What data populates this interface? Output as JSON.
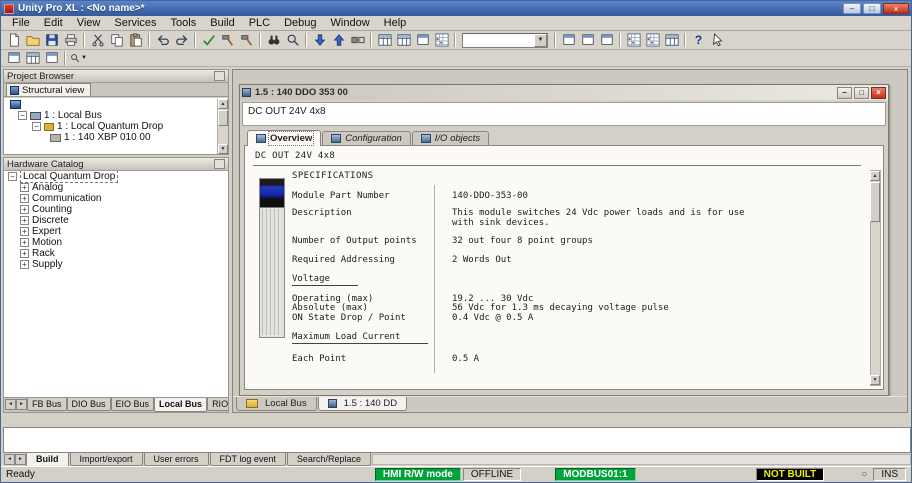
{
  "titlebar": {
    "title": "Unity Pro XL : <No name>*"
  },
  "menu": {
    "items": [
      "File",
      "Edit",
      "View",
      "Services",
      "Tools",
      "Build",
      "PLC",
      "Debug",
      "Window",
      "Help"
    ]
  },
  "toolbar": {
    "combo_value": ""
  },
  "icons": {
    "minimize": "–",
    "maximize": "□",
    "close": "×",
    "dropdown": "▼",
    "up_arrow": "▲",
    "down_arrow": "▼",
    "left_arrow": "◄",
    "right_arrow": "►",
    "collapse": "−",
    "expand": "+",
    "help": "?",
    "circle": "○"
  },
  "project_browser": {
    "title": "Project Browser",
    "view_tab": "Structural view",
    "tree": {
      "bus": "1 : Local Bus",
      "drop": "1 : Local Quantum Drop",
      "rack": "1 : 140 XBP 010 00"
    }
  },
  "hardware_catalog": {
    "title": "Hardware Catalog",
    "root": "Local Quantum Drop",
    "items": [
      "Analog",
      "Communication",
      "Counting",
      "Discrete",
      "Expert",
      "Motion",
      "Rack",
      "Supply"
    ],
    "tabs": [
      "FB Bus",
      "DIO Bus",
      "EIO Bus",
      "Local Bus",
      "RIO"
    ]
  },
  "module_window": {
    "title": "1.5 : 140 DDO 353 00",
    "subtitle": "DC OUT 24V 4x8",
    "tabs": {
      "overview": "Overview",
      "configuration": "Configuration",
      "io_objects": "I/O objects"
    },
    "content_title": "DC OUT 24V 4x8",
    "specs_heading": "SPECIFICATIONS",
    "specs": {
      "part_label": "Module Part Number",
      "part_value": "140-DDO-353-00",
      "desc_label": "Description",
      "desc_value": "This module switches 24 Vdc power loads and is for use with sink devices.",
      "points_label": "Number of Output points",
      "points_value": "32 out four 8 point groups",
      "addr_label": "Required Addressing",
      "addr_value": "2 Words Out",
      "voltage_heading": "Voltage",
      "operating_label": "Operating (max)",
      "operating_value": "19.2 ... 30 Vdc",
      "absolute_label": "Absolute (max)",
      "absolute_value": "56 Vdc for 1.3 ms decaying voltage pulse",
      "drop_label": "ON State Drop / Point",
      "drop_value": "0.4 Vdc @ 0.5 A",
      "load_heading": "Maximum Load Current",
      "each_label": "Each Point",
      "each_value": "0.5 A"
    }
  },
  "mdi_tabs": {
    "local_bus": "Local Bus",
    "module": "1.5 : 140 DD"
  },
  "output_panel": {
    "tabs": [
      "Build",
      "Import/export",
      "User errors",
      "FDT log event",
      "Search/Replace"
    ]
  },
  "status_bar": {
    "ready": "Ready",
    "hmi_mode": "HMI R/W mode",
    "connection": "OFFLINE",
    "modbus": "MODBUS01:1",
    "build_state": "NOT BUILT",
    "ins": "INS"
  }
}
